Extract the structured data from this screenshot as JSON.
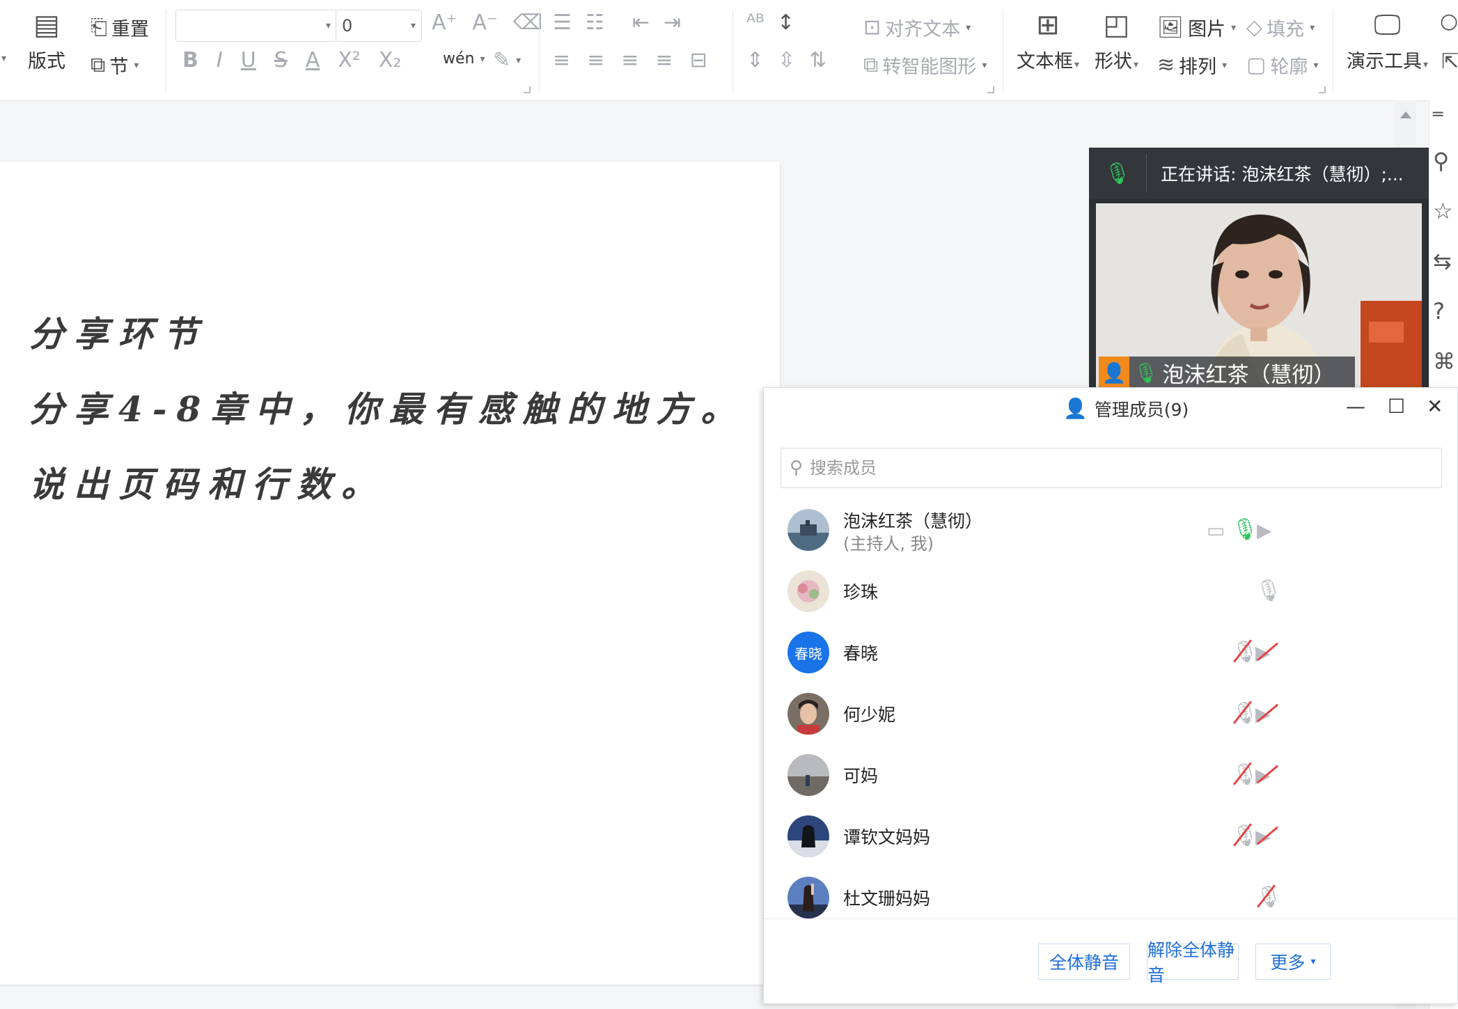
{
  "ribbon": {
    "reset_label": "重置",
    "layout_label": "版式",
    "section_label": "节",
    "font_name_value": "",
    "font_size_value": "0",
    "align_text_label": "对齐文本",
    "smart_shape_label": "转智能图形",
    "textbox_label": "文本框",
    "shape_label": "形状",
    "picture_label": "图片",
    "arrange_label": "排列",
    "fill_label": "填充",
    "outline_label": "轮廓",
    "present_tools_label": "演示工具",
    "pinyin_label": "wén"
  },
  "document": {
    "lines": [
      "分享环节",
      "分享4-8章中，你最有感触的地方。",
      "说出页码和行数。"
    ]
  },
  "video": {
    "speaking_text": "正在讲话: 泡沫红茶（慧彻）;...",
    "participant_name": "泡沫红茶（慧彻）"
  },
  "members": {
    "title": "管理成员(9)",
    "search_placeholder": "搜索成员",
    "list": [
      {
        "name": "泡沫红茶（慧彻）",
        "sub": "(主持人, 我)",
        "avatar_color": "#5b7fa5"
      },
      {
        "name": "珍珠",
        "sub": "",
        "avatar_color": "#b9a88f"
      },
      {
        "name": "春晓",
        "sub": "",
        "avatar_text": "春晓",
        "avatar_color": "#1a73e8"
      },
      {
        "name": "何少妮",
        "sub": "",
        "avatar_color": "#8c6f5e"
      },
      {
        "name": "可妈",
        "sub": "",
        "avatar_color": "#7d8287"
      },
      {
        "name": "谭钦文妈妈",
        "sub": "",
        "avatar_color": "#34508a"
      },
      {
        "name": "杜文珊妈妈",
        "sub": "",
        "avatar_color": "#4a6aa8"
      }
    ],
    "mute_all_label": "全体静音",
    "unmute_all_label": "解除全体静音",
    "more_label": "更多"
  },
  "colors": {
    "accent_blue": "#1f6fd8",
    "mic_green": "#2fc45a",
    "mute_red": "#e64545",
    "video_header": "#33363b"
  }
}
